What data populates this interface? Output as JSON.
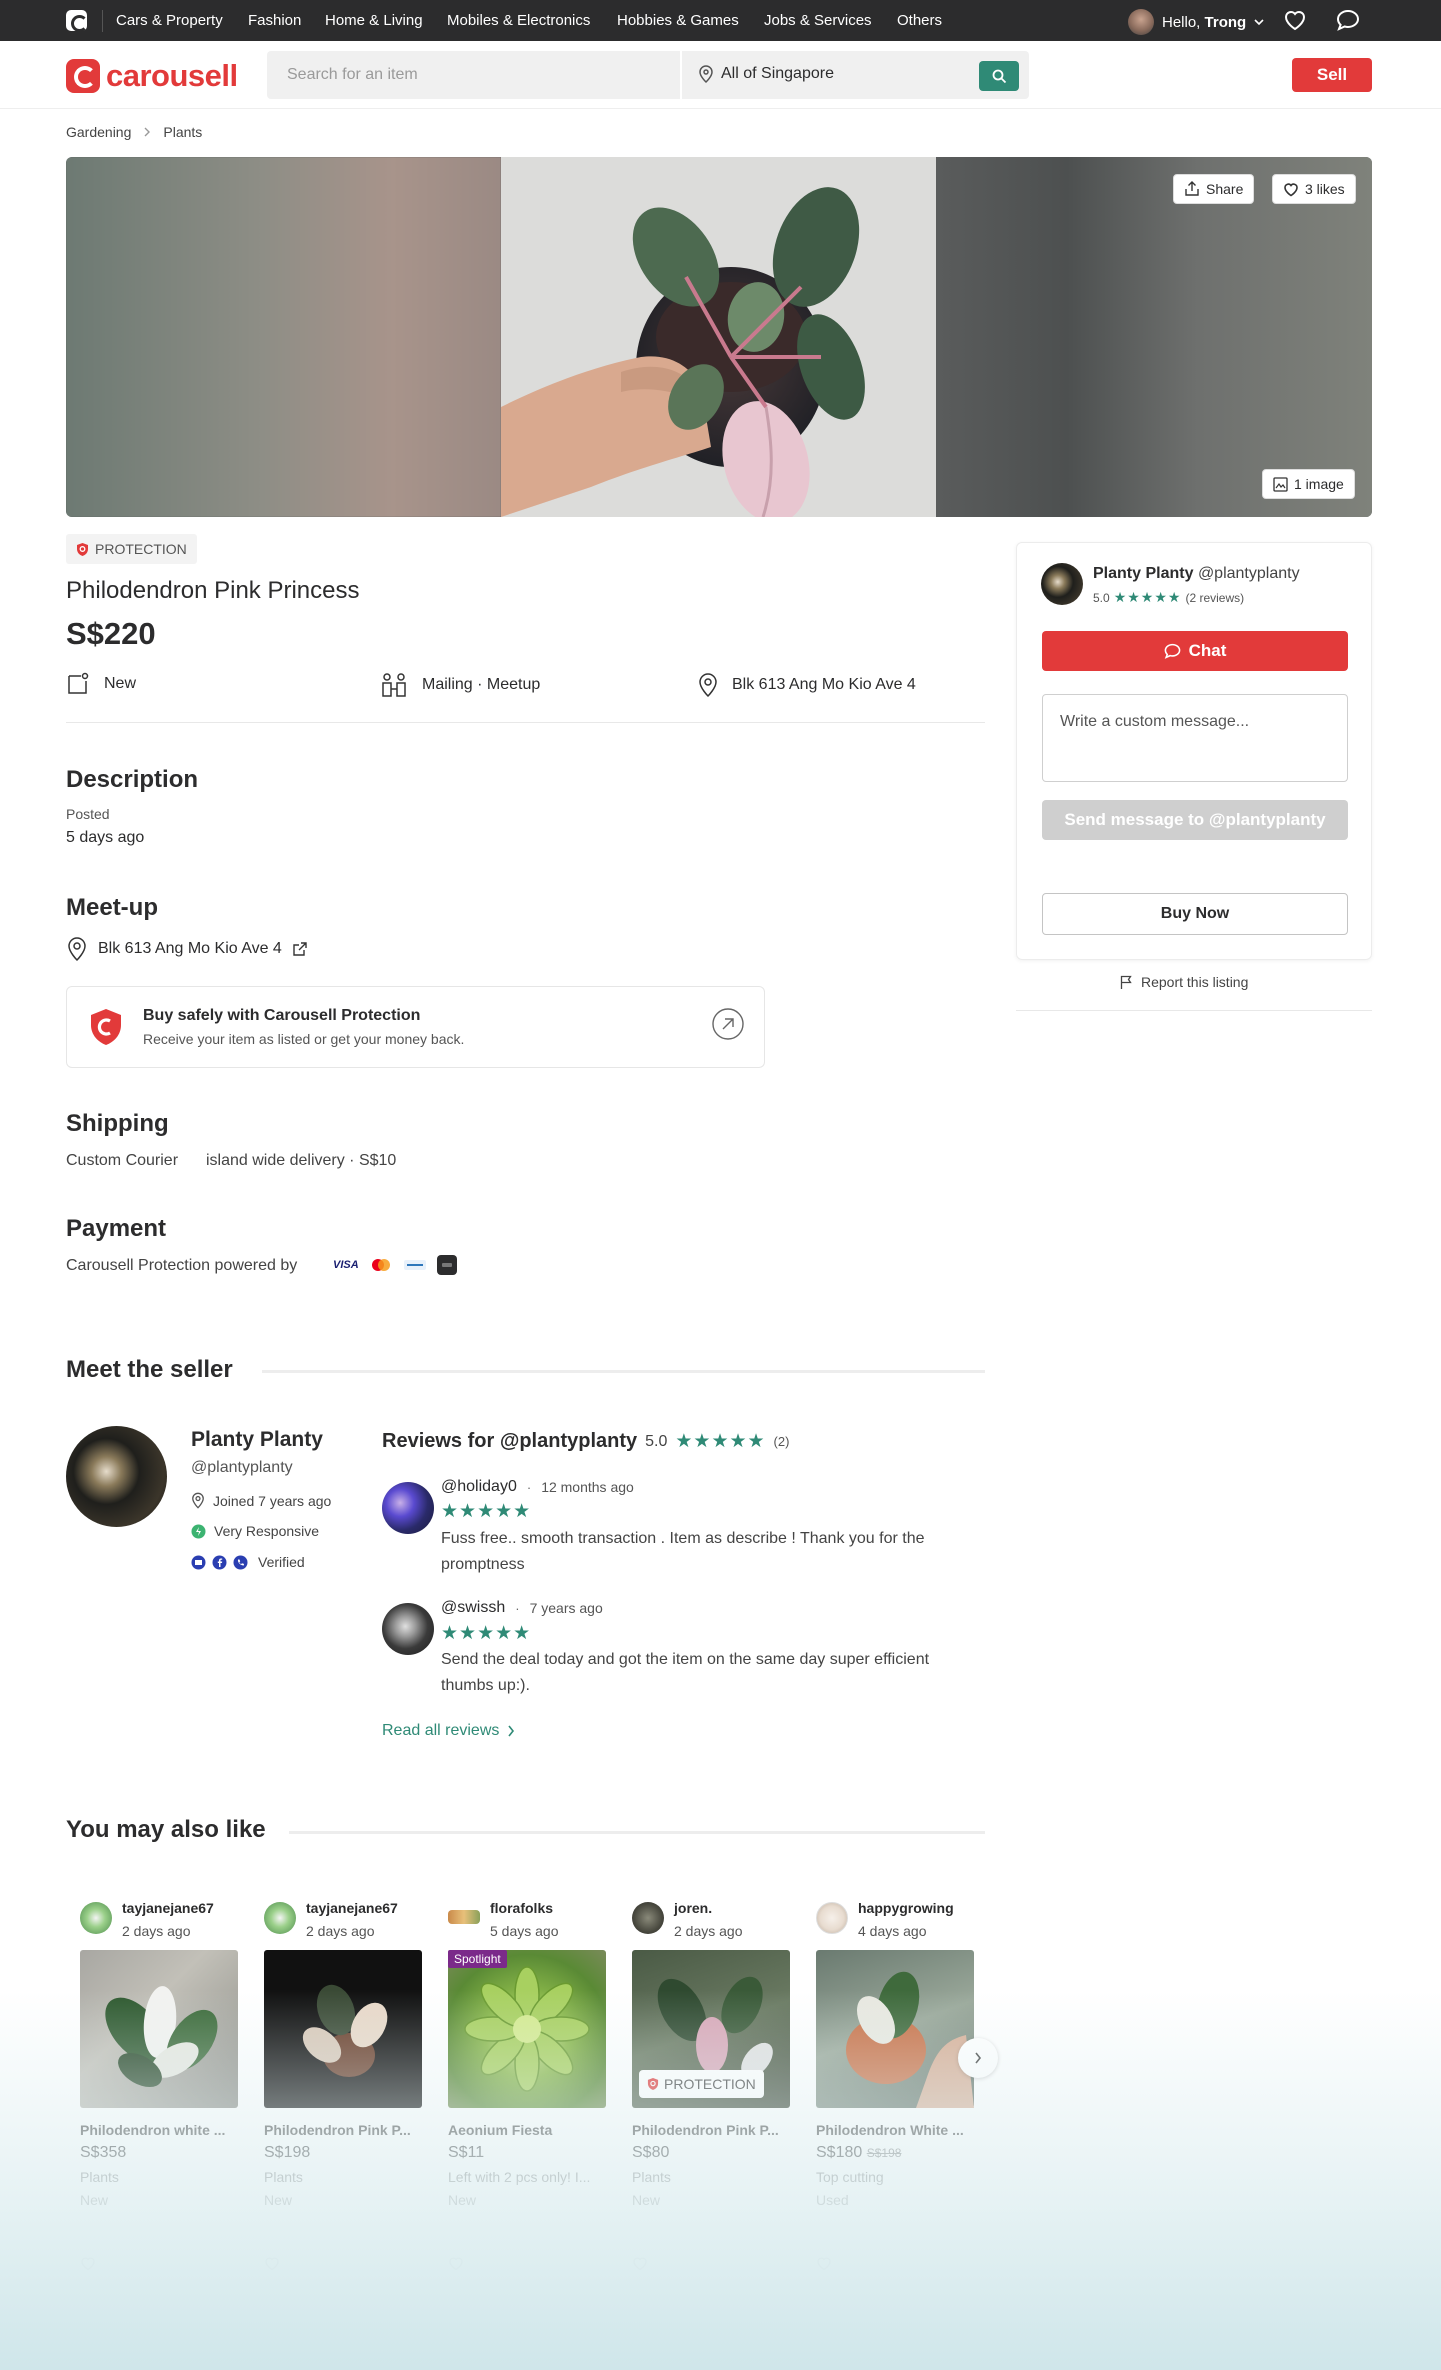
{
  "topnav": {
    "categories": [
      "Cars & Property",
      "Fashion",
      "Home & Living",
      "Mobiles & Electronics",
      "Hobbies & Games",
      "Jobs & Services",
      "Others"
    ],
    "greeting": "Hello, ",
    "user_name": "Trong"
  },
  "header": {
    "brand": "carousell",
    "search_placeholder": "Search for an item",
    "location": "All of Singapore",
    "sell_label": "Sell"
  },
  "breadcrumbs": [
    "Gardening",
    "Plants"
  ],
  "gallery": {
    "share_label": "Share",
    "likes_label": "3 likes",
    "image_count_label": "1 image"
  },
  "listing": {
    "protection_badge": "PROTECTION",
    "title": "Philodendron Pink Princess",
    "price": "S$220",
    "condition": "New",
    "delivery": "Mailing · Meetup",
    "location": "Blk 613 Ang Mo Kio Ave 4"
  },
  "description": {
    "heading": "Description",
    "posted_label": "Posted",
    "posted_value": "5 days ago"
  },
  "meetup": {
    "heading": "Meet-up",
    "location": "Blk 613 Ang Mo Kio Ave 4"
  },
  "protection_card": {
    "title": "Buy safely with Carousell Protection",
    "subtitle": "Receive your item as listed or get your money back."
  },
  "shipping": {
    "heading": "Shipping",
    "method": "Custom Courier",
    "detail": "island wide delivery · S$10"
  },
  "payment": {
    "heading": "Payment",
    "text": "Carousell Protection powered by",
    "visa": "VISA"
  },
  "seller_card": {
    "name": "Planty Planty",
    "handle": "@plantyplanty",
    "rating": "5.0",
    "stars": "★★★★★",
    "reviews": "(2 reviews)",
    "chat_label": "Chat",
    "message_placeholder": "Write a custom message...",
    "send_label": "Send message to @plantyplanty",
    "buy_label": "Buy Now",
    "report_label": "Report this listing"
  },
  "meet_seller": {
    "heading": "Meet the seller",
    "name": "Planty Planty",
    "handle": "@plantyplanty",
    "joined": "Joined 7 years ago",
    "responsive": "Very Responsive",
    "verified": "Verified",
    "reviews_heading": "Reviews for @plantyplanty",
    "rating": "5.0",
    "stars": "★★★★★",
    "count": "(2)",
    "reviews": [
      {
        "user": "@holiday0",
        "time": "12 months ago",
        "stars": "★★★★★",
        "text": "Fuss free.. smooth transaction . Item as describe ! Thank you for the promptness"
      },
      {
        "user": "@swissh",
        "time": "7 years ago",
        "stars": "★★★★★",
        "text": "Send the deal today and got the item on the same day super efficient thumbs up:)."
      }
    ],
    "read_all": "Read all reviews"
  },
  "recommendations": {
    "heading": "You may also like",
    "items": [
      {
        "seller": "tayjanejane67",
        "time": "2 days ago",
        "title": "Philodendron white ...",
        "price": "S$358",
        "old_price": "",
        "category": "Plants",
        "condition": "New",
        "tag": ""
      },
      {
        "seller": "tayjanejane67",
        "time": "2 days ago",
        "title": "Philodendron Pink P...",
        "price": "S$198",
        "old_price": "",
        "category": "Plants",
        "condition": "New",
        "tag": ""
      },
      {
        "seller": "florafolks",
        "time": "5 days ago",
        "title": "Aeonium Fiesta",
        "price": "S$11",
        "old_price": "",
        "category": "Left with 2 pcs only! I...",
        "condition": "New",
        "tag": "Spotlight"
      },
      {
        "seller": "joren.",
        "time": "2 days ago",
        "title": "Philodendron Pink P...",
        "price": "S$80",
        "old_price": "",
        "category": "Plants",
        "condition": "New",
        "tag": "PROTECTION"
      },
      {
        "seller": "happygrowing",
        "time": "4 days ago",
        "title": "Philodendron White ...",
        "price": "S$180",
        "old_price": "S$198",
        "category": "Top cutting",
        "condition": "Used",
        "tag": ""
      }
    ]
  },
  "colors": {
    "brand_red": "#e23a3a",
    "accent_green": "#2f8a76",
    "dark": "#2c2c2d"
  }
}
